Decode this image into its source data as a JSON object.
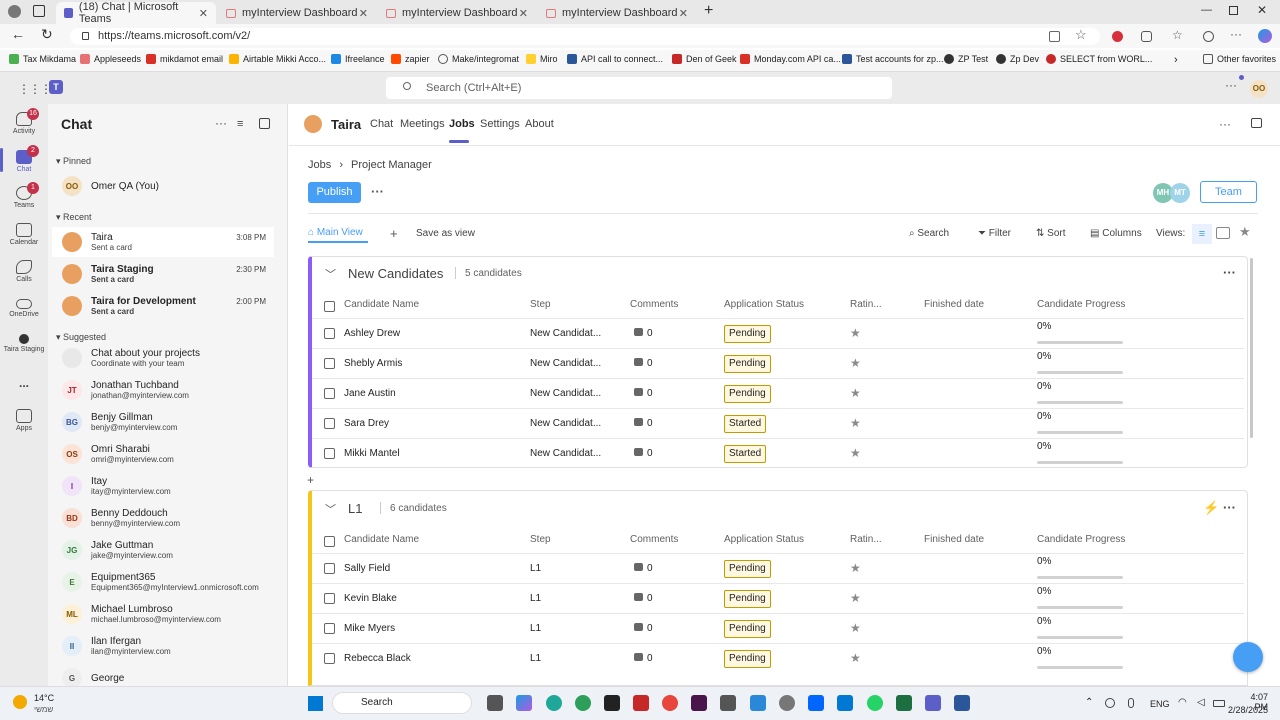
{
  "browser": {
    "tabs": [
      {
        "title": "(18) Chat | Microsoft Teams"
      },
      {
        "title": "myInterview Dashboard"
      },
      {
        "title": "myInterview Dashboard"
      },
      {
        "title": "myInterview Dashboard"
      }
    ],
    "url": "https://teams.microsoft.com/v2/",
    "bookmarks": [
      "Tax Mikdama",
      "Appleseeds",
      "mikdamot email",
      "Airtable Mikki Acco...",
      "Ifreelance",
      "zapier",
      "Make/integromat",
      "Miro",
      "API call to connect...",
      "Den of Geek",
      "Monday.com API ca...",
      "Test accounts for zp...",
      "ZP Test",
      "Zp Dev",
      "SELECT from WORL...",
      "Other favorites"
    ]
  },
  "teams": {
    "search_placeholder": "Search (Ctrl+Alt+E)",
    "user_initials": "OO",
    "rail": [
      {
        "label": "Activity",
        "badge": "16"
      },
      {
        "label": "Chat",
        "badge": "2"
      },
      {
        "label": "Teams",
        "badge": "1"
      },
      {
        "label": "Calendar"
      },
      {
        "label": "Calls"
      },
      {
        "label": "OneDrive"
      },
      {
        "label": "Taira Staging"
      },
      {
        "label": "..."
      },
      {
        "label": "Apps"
      }
    ]
  },
  "chat": {
    "title": "Chat",
    "pinned_label": "Pinned",
    "recent_label": "Recent",
    "suggested_label": "Suggested",
    "pinned": [
      {
        "initials": "OO",
        "name": "Omer QA (You)"
      }
    ],
    "recent": [
      {
        "name": "Taira",
        "sub": "Sent a card",
        "time": "3:08 PM"
      },
      {
        "name": "Taira Staging",
        "sub": "Sent a card",
        "time": "2:30 PM"
      },
      {
        "name": "Taira for Development",
        "sub": "Sent a card",
        "time": "2:00 PM"
      }
    ],
    "suggested": [
      {
        "initials": "",
        "name": "Chat about your projects",
        "sub": "Coordinate with your team"
      },
      {
        "initials": "JT",
        "name": "Jonathan Tuchband",
        "sub": "jonathan@myinterview.com"
      },
      {
        "initials": "BG",
        "name": "Benjy Gillman",
        "sub": "benjy@myinterview.com"
      },
      {
        "initials": "OS",
        "name": "Omri Sharabi",
        "sub": "omri@myinterview.com"
      },
      {
        "initials": "I",
        "name": "Itay",
        "sub": "itay@myinterview.com"
      },
      {
        "initials": "BD",
        "name": "Benny Deddouch",
        "sub": "benny@myinterview.com"
      },
      {
        "initials": "JG",
        "name": "Jake Guttman",
        "sub": "jake@myinterview.com"
      },
      {
        "initials": "E",
        "name": "Equipment365",
        "sub": "Equipment365@myInterview1.onmicrosoft.com"
      },
      {
        "initials": "ML",
        "name": "Michael Lumbroso",
        "sub": "michael.lumbroso@myinterview.com"
      },
      {
        "initials": "II",
        "name": "Ilan Ifergan",
        "sub": "ilan@myinterview.com"
      },
      {
        "initials": "G",
        "name": "George",
        "sub": ""
      }
    ]
  },
  "app": {
    "name": "Taira",
    "nav": [
      "Chat",
      "Meetings",
      "Jobs",
      "Settings",
      "About"
    ],
    "breadcrumb": [
      "Jobs",
      "Project Manager"
    ],
    "publish_label": "Publish",
    "team_label": "Team",
    "avatars": [
      "MH",
      "MT"
    ],
    "main_view_label": "Main View",
    "save_view_label": "Save as view",
    "toolbar": {
      "search": "Search",
      "filter": "Filter",
      "sort": "Sort",
      "columns": "Columns",
      "views": "Views:"
    },
    "columns": [
      "Candidate Name",
      "Step",
      "Comments",
      "Application Status",
      "Ratin...",
      "Finished date",
      "Candidate Progress"
    ],
    "groups": [
      {
        "title": "New Candidates",
        "count": "5 candidates",
        "rows": [
          {
            "name": "Ashley Drew",
            "step": "New Candidat...",
            "comments": "0",
            "status": "Pending",
            "progress": "0%"
          },
          {
            "name": "Shebly Armis",
            "step": "New Candidat...",
            "comments": "0",
            "status": "Pending",
            "progress": "0%"
          },
          {
            "name": "Jane Austin",
            "step": "New Candidat...",
            "comments": "0",
            "status": "Pending",
            "progress": "0%"
          },
          {
            "name": "Sara Drey",
            "step": "New Candidat...",
            "comments": "0",
            "status": "Started",
            "progress": "0%"
          },
          {
            "name": "Mikki Mantel",
            "step": "New Candidat...",
            "comments": "0",
            "status": "Started",
            "progress": "0%"
          }
        ]
      },
      {
        "title": "L1",
        "count": "6 candidates",
        "rows": [
          {
            "name": "Sally Field",
            "step": "L1",
            "comments": "0",
            "status": "Pending",
            "progress": "0%"
          },
          {
            "name": "Kevin Blake",
            "step": "L1",
            "comments": "0",
            "status": "Pending",
            "progress": "0%"
          },
          {
            "name": "Mike Myers",
            "step": "L1",
            "comments": "0",
            "status": "Pending",
            "progress": "0%"
          },
          {
            "name": "Rebecca Black",
            "step": "L1",
            "comments": "0",
            "status": "Pending",
            "progress": "0%"
          }
        ]
      }
    ]
  },
  "taskbar": {
    "weather_temp": "14°C",
    "weather_text": "שמשי",
    "search_label": "Search",
    "lang": "ENG",
    "time": "4:07 PM",
    "date": "2/28/2025"
  },
  "colors": {
    "accent": "#5b5fc7",
    "publish": "#479ef5",
    "pending_border": "#c49a00",
    "group1": "#8b5cf6",
    "group2": "#f5c518"
  }
}
